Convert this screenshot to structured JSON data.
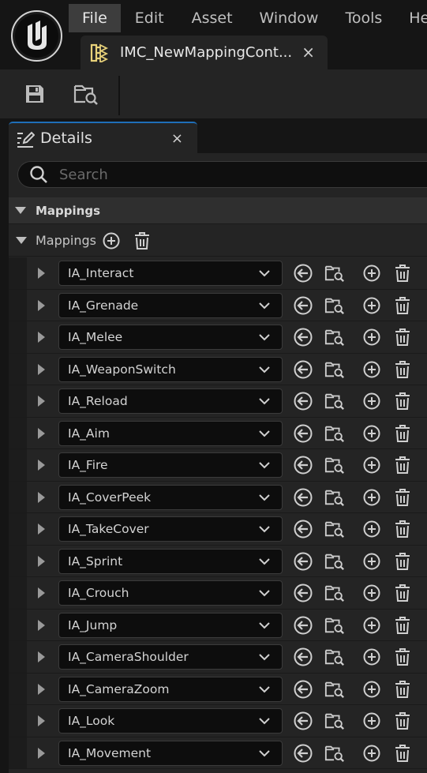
{
  "menu": {
    "items": [
      "File",
      "Edit",
      "Asset",
      "Window",
      "Tools",
      "He"
    ]
  },
  "document_tab": {
    "label": "IMC_NewMappingCont...",
    "close": "×"
  },
  "details": {
    "tab_label": "Details",
    "close": "×",
    "search_placeholder": "Search",
    "category_label": "Mappings",
    "mappings_label": "Mappings"
  },
  "mappings": [
    "IA_Interact",
    "IA_Grenade",
    "IA_Melee",
    "IA_WeaponSwitch",
    "IA_Reload",
    "IA_Aim",
    "IA_Fire",
    "IA_CoverPeek",
    "IA_TakeCover",
    "IA_Sprint",
    "IA_Crouch",
    "IA_Jump",
    "IA_CameraShoulder",
    "IA_CameraZoom",
    "IA_Look",
    "IA_Movement"
  ],
  "colors": {
    "accent": "#1f6fb8",
    "panel_bg": "#242424",
    "app_bg": "#151515",
    "menu_active": "#3d3d3d",
    "asset_icon": "#e8d27a"
  }
}
